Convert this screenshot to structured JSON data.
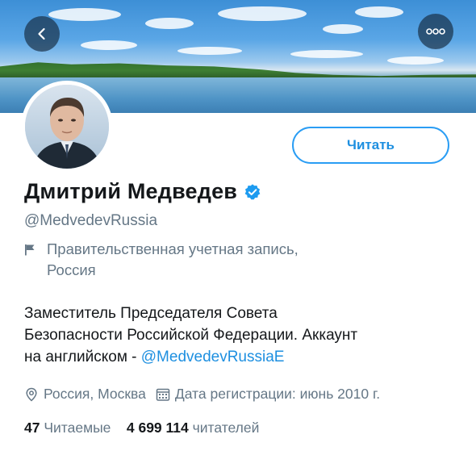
{
  "profile": {
    "name": "Дмитрий Медведев",
    "handle": "@MedvedevRussia",
    "gov_label_line1": "Правительственная учетная запись,",
    "gov_label_line2": "Россия",
    "bio_line1": "Заместитель Председателя Совета",
    "bio_line2": "Безопасности Российской Федерации. Аккаунт",
    "bio_line3_prefix": "на английском - ",
    "bio_mention": "@MedvedevRussiaE",
    "location": "Россия, Москва",
    "joined": "Дата регистрации: июнь 2010 г.",
    "following_count": "47",
    "following_label": "Читаемые",
    "followers_count": "4 699 114",
    "followers_label": "читателей"
  },
  "actions": {
    "follow_label": "Читать"
  },
  "icons": {
    "back": "back-arrow-icon",
    "more": "more-options-icon",
    "verified": "verified-badge-icon",
    "gov_flag": "flag-icon",
    "location": "location-pin-icon",
    "calendar": "calendar-icon"
  },
  "colors": {
    "accent": "#1d8fe0",
    "text_primary": "#14171a",
    "text_secondary": "#657786"
  }
}
